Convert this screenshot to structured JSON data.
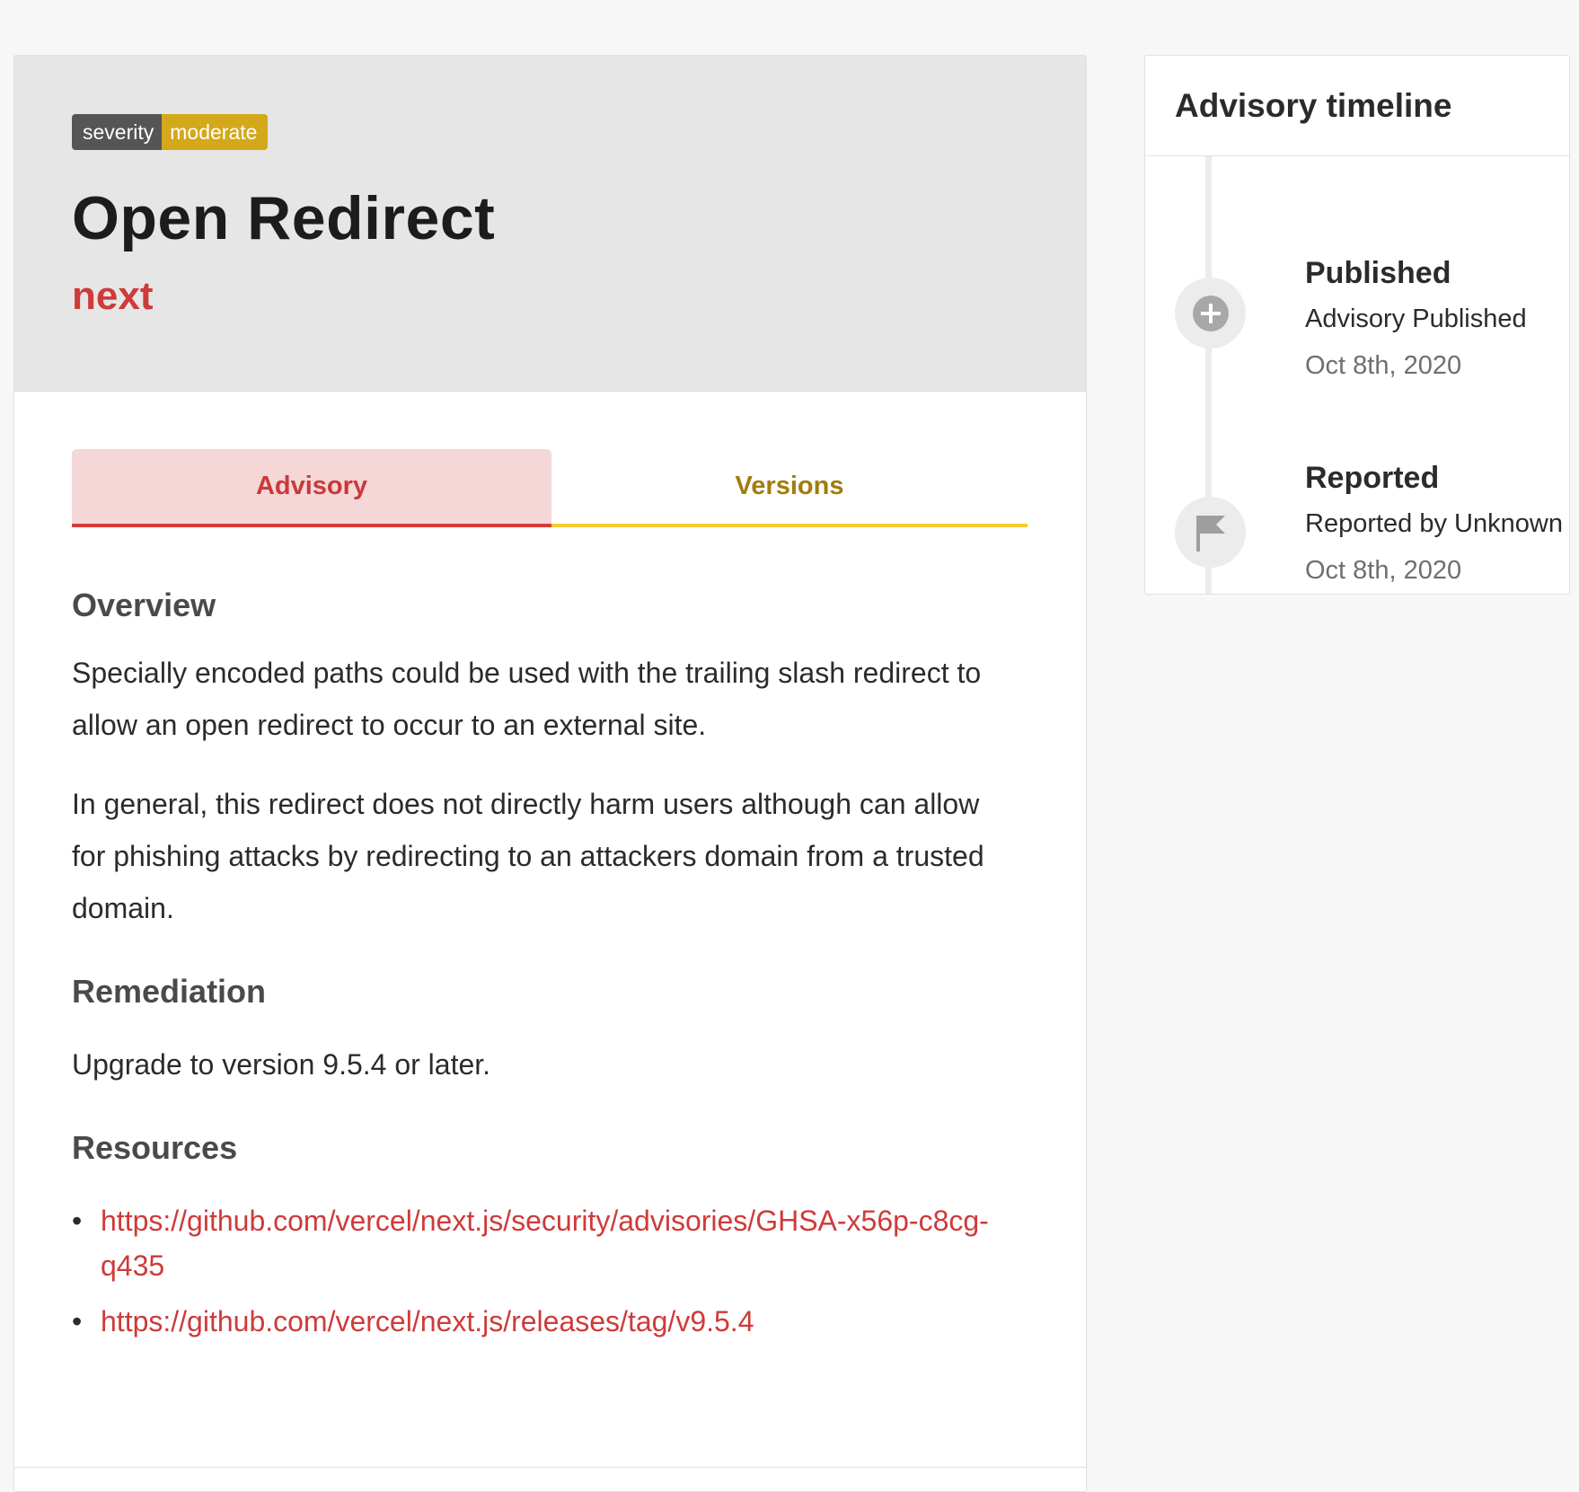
{
  "severity_badge": {
    "label": "severity",
    "value": "moderate"
  },
  "advisory": {
    "title": "Open Redirect",
    "package": "next"
  },
  "tabs": [
    {
      "label": "Advisory",
      "active": true
    },
    {
      "label": "Versions",
      "active": false
    }
  ],
  "overview": {
    "heading": "Overview",
    "paragraphs": [
      "Specially encoded paths could be used with the trailing slash redirect to allow an open redirect to occur to an external site.",
      "In general, this redirect does not directly harm users although can allow for phishing attacks by redirecting to an attackers domain from a trusted domain."
    ]
  },
  "remediation": {
    "heading": "Remediation",
    "text": "Upgrade to version 9.5.4 or later."
  },
  "resources": {
    "heading": "Resources",
    "links": [
      "https://github.com/vercel/next.js/security/advisories/GHSA-x56p-c8cg-q435",
      "https://github.com/vercel/next.js/releases/tag/v9.5.4"
    ]
  },
  "timeline": {
    "heading": "Advisory timeline",
    "events": [
      {
        "title": "Published",
        "description": "Advisory Published",
        "date": "Oct 8th, 2020",
        "icon": "plus-circle-icon"
      },
      {
        "title": "Reported",
        "description": "Reported by Unknown",
        "date": "Oct 8th, 2020",
        "icon": "flag-icon"
      }
    ]
  },
  "colors": {
    "accent_red": "#cf3a3a",
    "badge_moderate": "#d3a91b",
    "versions_tab": "#a27c0a"
  }
}
